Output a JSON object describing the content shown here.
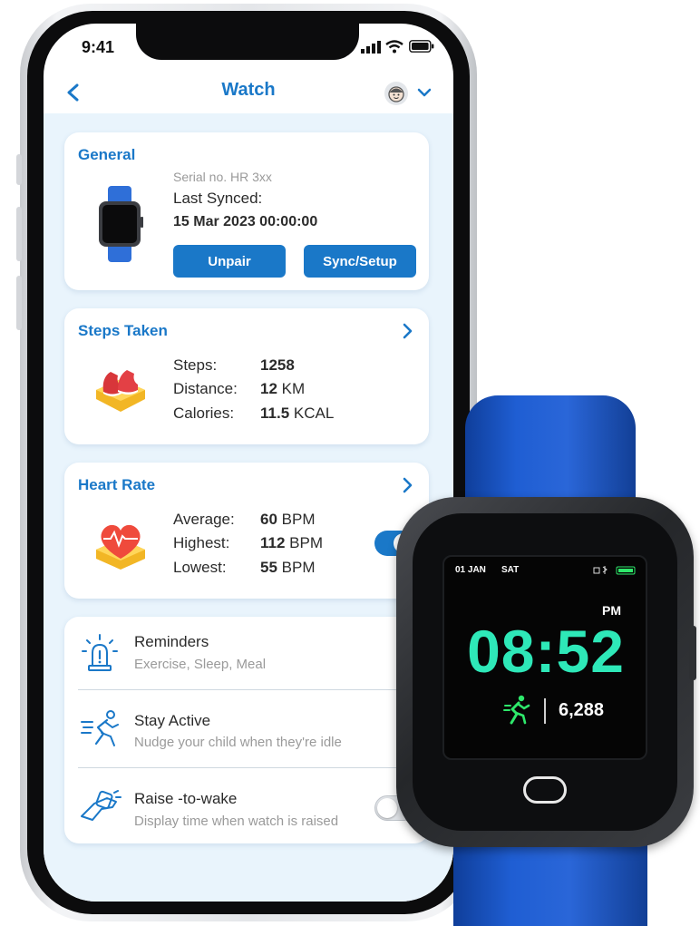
{
  "status": {
    "time": "9:41"
  },
  "header": {
    "title": "Watch"
  },
  "general": {
    "title": "General",
    "serial": "Serial no. HR 3xx",
    "last_synced_label": "Last Synced:",
    "last_synced_value": "15 Mar 2023 00:00:00",
    "unpair_label": "Unpair",
    "sync_label": "Sync/Setup"
  },
  "steps": {
    "title": "Steps Taken",
    "rows": [
      {
        "label": "Steps:",
        "value": "1258",
        "unit": ""
      },
      {
        "label": "Distance:",
        "value": "12",
        "unit": "KM"
      },
      {
        "label": "Calories:",
        "value": "11.5",
        "unit": "KCAL"
      }
    ]
  },
  "heart": {
    "title": "Heart Rate",
    "rows": [
      {
        "label": "Average:",
        "value": "60",
        "unit": "BPM"
      },
      {
        "label": "Highest:",
        "value": "112",
        "unit": "BPM"
      },
      {
        "label": "Lowest:",
        "value": "55",
        "unit": "BPM"
      }
    ],
    "toggle_on": true
  },
  "settings": [
    {
      "title": "Reminders",
      "subtitle": "Exercise, Sleep, Meal"
    },
    {
      "title": "Stay Active",
      "subtitle": "Nudge your child when they're idle"
    },
    {
      "title": "Raise -to-wake",
      "subtitle": "Display time when watch is raised"
    }
  ],
  "watch_face": {
    "date": "01 JAN",
    "day": "SAT",
    "ampm": "PM",
    "time": "08:52",
    "steps": "6,288"
  },
  "colors": {
    "accent": "#1a78c8",
    "watch_time": "#2ee8b8",
    "strap": "#1f5ed3"
  }
}
